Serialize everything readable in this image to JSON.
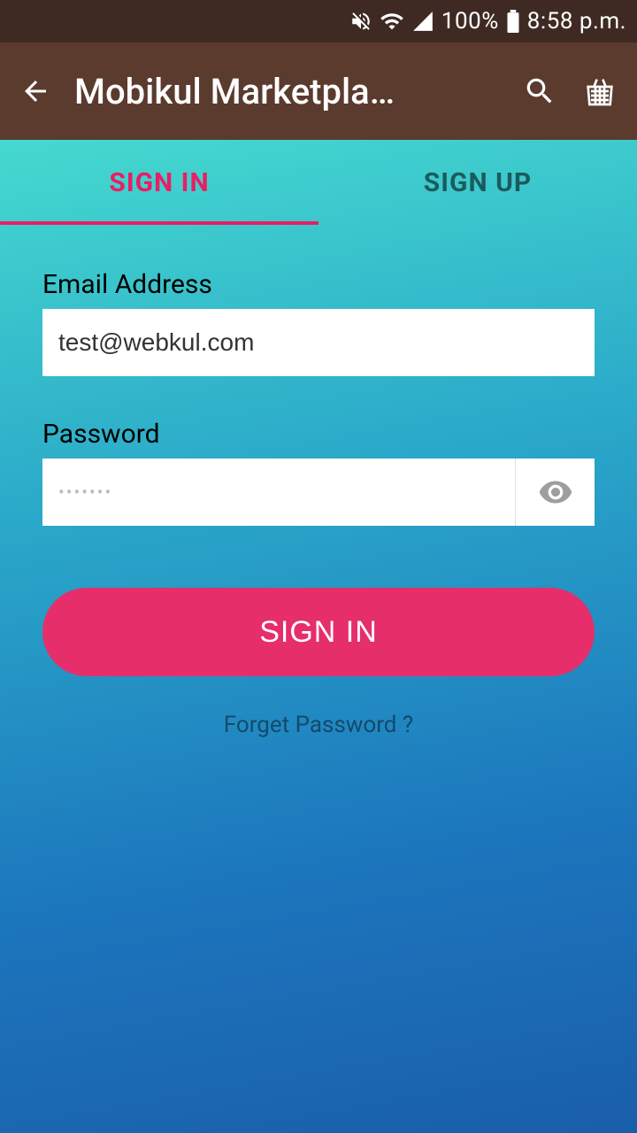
{
  "status": {
    "battery": "100%",
    "time": "8:58 p.m."
  },
  "appbar": {
    "title": "Mobikul Marketpla…"
  },
  "tabs": {
    "signin": "SIGN IN",
    "signup": "SIGN UP"
  },
  "form": {
    "email_label": "Email Address",
    "email_value": "test@webkul.com",
    "password_label": "Password",
    "password_mask": "•••••••",
    "signin_button": "SIGN IN",
    "forget": "Forget Password ?"
  },
  "icons": {
    "mute": "mute-icon",
    "wifi": "wifi-icon",
    "signal": "signal-icon",
    "battery": "battery-icon",
    "back": "back-arrow-icon",
    "search": "search-icon",
    "basket": "basket-icon",
    "eye": "eye-icon"
  }
}
